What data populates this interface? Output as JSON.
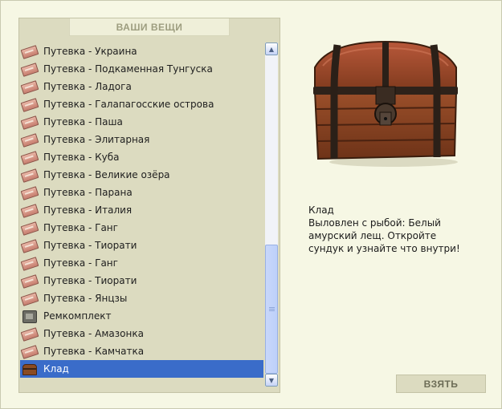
{
  "panel": {
    "title": "ВАШИ ВЕЩИ"
  },
  "items": [
    {
      "label": "Путевка - Украина",
      "icon": "ticket-icon"
    },
    {
      "label": "Путевка - Подкаменная Тунгуска",
      "icon": "ticket-icon"
    },
    {
      "label": "Путевка - Ладога",
      "icon": "ticket-icon"
    },
    {
      "label": "Путевка - Галапагосские острова",
      "icon": "ticket-icon"
    },
    {
      "label": "Путевка - Паша",
      "icon": "ticket-icon"
    },
    {
      "label": "Путевка - Элитарная",
      "icon": "ticket-icon"
    },
    {
      "label": "Путевка - Куба",
      "icon": "ticket-icon"
    },
    {
      "label": "Путевка - Великие озёра",
      "icon": "ticket-icon"
    },
    {
      "label": "Путевка - Парана",
      "icon": "ticket-icon"
    },
    {
      "label": "Путевка - Италия",
      "icon": "ticket-icon"
    },
    {
      "label": "Путевка - Ганг",
      "icon": "ticket-icon"
    },
    {
      "label": "Путевка - Тиорати",
      "icon": "ticket-icon"
    },
    {
      "label": "Путевка - Ганг",
      "icon": "ticket-icon"
    },
    {
      "label": "Путевка - Тиорати",
      "icon": "ticket-icon"
    },
    {
      "label": "Путевка - Янцзы",
      "icon": "ticket-icon"
    },
    {
      "label": "Ремкомплект",
      "icon": "repair-kit-icon"
    },
    {
      "label": "Путевка - Амазонка",
      "icon": "ticket-icon"
    },
    {
      "label": "Путевка - Камчатка",
      "icon": "ticket-icon"
    },
    {
      "label": "Клад",
      "icon": "treasure-chest-icon",
      "selected": true
    }
  ],
  "detail": {
    "name": "Клад",
    "description": "Выловлен с рыбой: Белый амурский лещ. Откройте сундук и узнайте что внутри!",
    "image_icon": "treasure-chest-icon"
  },
  "actions": {
    "take_label": "ВЗЯТЬ"
  },
  "colors": {
    "selection": "#3a6cc9",
    "panel": "#dcdbc0",
    "background": "#f6f7e4"
  }
}
